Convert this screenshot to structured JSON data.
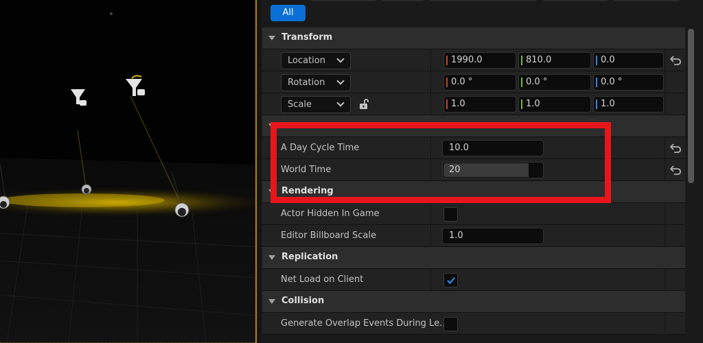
{
  "filter": {
    "all_label": "All"
  },
  "sections": {
    "transform": "Transform",
    "rendering": "Rendering",
    "replication": "Replication",
    "collision": "Collision"
  },
  "transform": {
    "location": {
      "label": "Location",
      "x": "1990.0",
      "y": "810.0",
      "z": "0.0"
    },
    "rotation": {
      "label": "Rotation",
      "x": "0.0 °",
      "y": "0.0 °",
      "z": "0.0 °"
    },
    "scale": {
      "label": "Scale",
      "x": "1.0",
      "y": "1.0",
      "z": "1.0"
    }
  },
  "custom": {
    "day_cycle": {
      "label": "A Day Cycle Time",
      "value": "10.0"
    },
    "world_time": {
      "label": "World Time",
      "value": "20",
      "fill_fraction": 0.86
    }
  },
  "rendering": {
    "actor_hidden": {
      "label": "Actor Hidden In Game",
      "checked": false
    },
    "billboard": {
      "label": "Editor Billboard Scale",
      "value": "1.0"
    }
  },
  "replication": {
    "net_load": {
      "label": "Net Load on Client",
      "checked": true
    }
  },
  "collision": {
    "overlap": {
      "label": "Generate Overlap Events During Le...",
      "checked": false
    }
  },
  "colors": {
    "accent": "#0a6fd6",
    "axis_x": "#c8402c",
    "axis_y": "#7cb82f",
    "axis_z": "#3b82e0",
    "highlight": "#e8161b"
  }
}
